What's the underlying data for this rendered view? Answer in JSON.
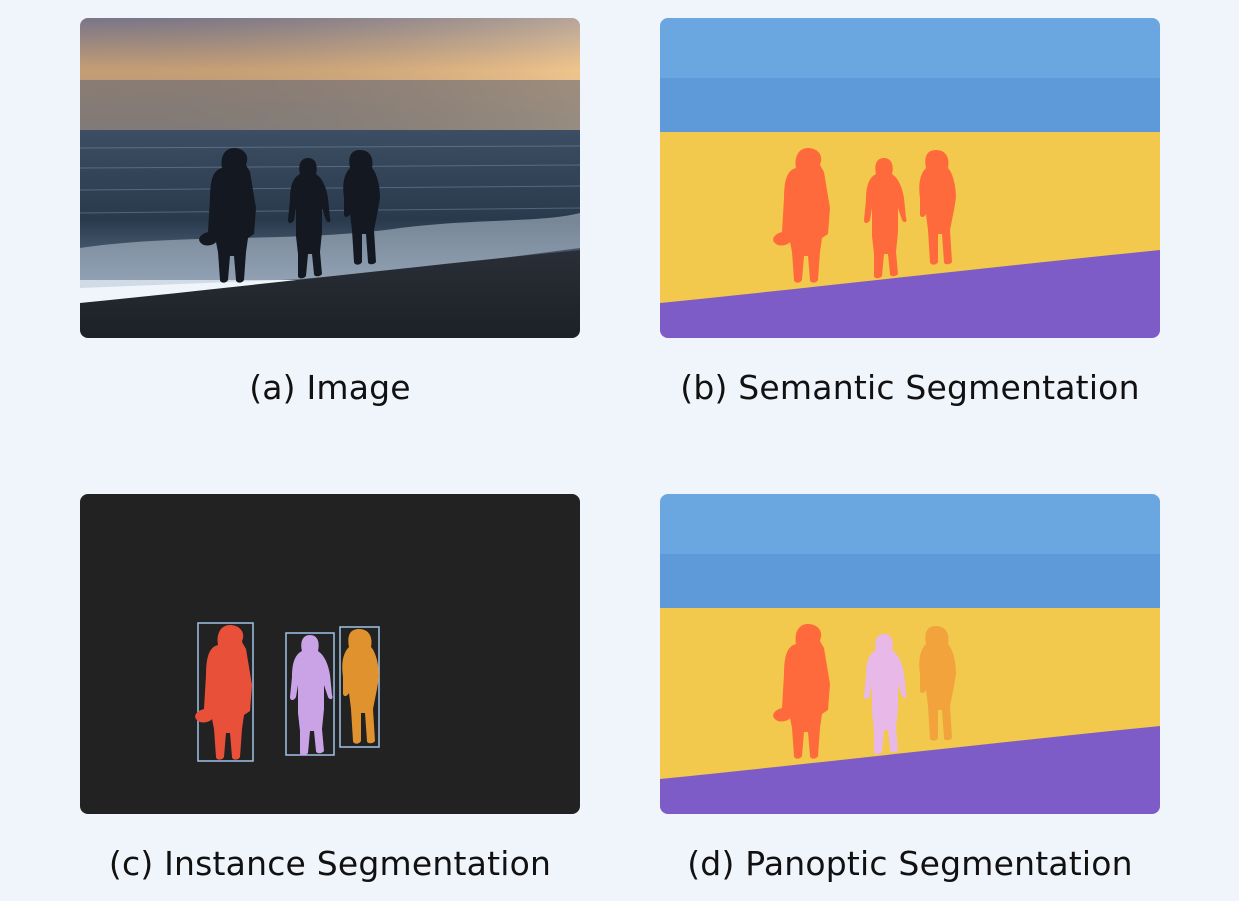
{
  "panels": [
    {
      "id": "a",
      "caption": "(a) Image"
    },
    {
      "id": "b",
      "caption": "(b) Semantic Segmentation",
      "colors": {
        "sky": "#6aa6e0",
        "sea": "#f2c94c",
        "sand": "#7e5cc7",
        "person": "#ff6a3d"
      }
    },
    {
      "id": "c",
      "caption": "(c) Instance Segmentation",
      "colors": {
        "background": "#222222",
        "person_1": "#e8503a",
        "person_2": "#c9a3e6",
        "person_3": "#e0922f",
        "box": "#9fc3e8"
      }
    },
    {
      "id": "d",
      "caption": "(d) Panoptic Segmentation",
      "colors": {
        "sky": "#6aa6e0",
        "sea": "#f2c94c",
        "sand": "#7e5cc7",
        "person_1": "#ff6a3d",
        "person_2": "#e8b8e8",
        "person_3": "#f2a33c"
      }
    }
  ]
}
